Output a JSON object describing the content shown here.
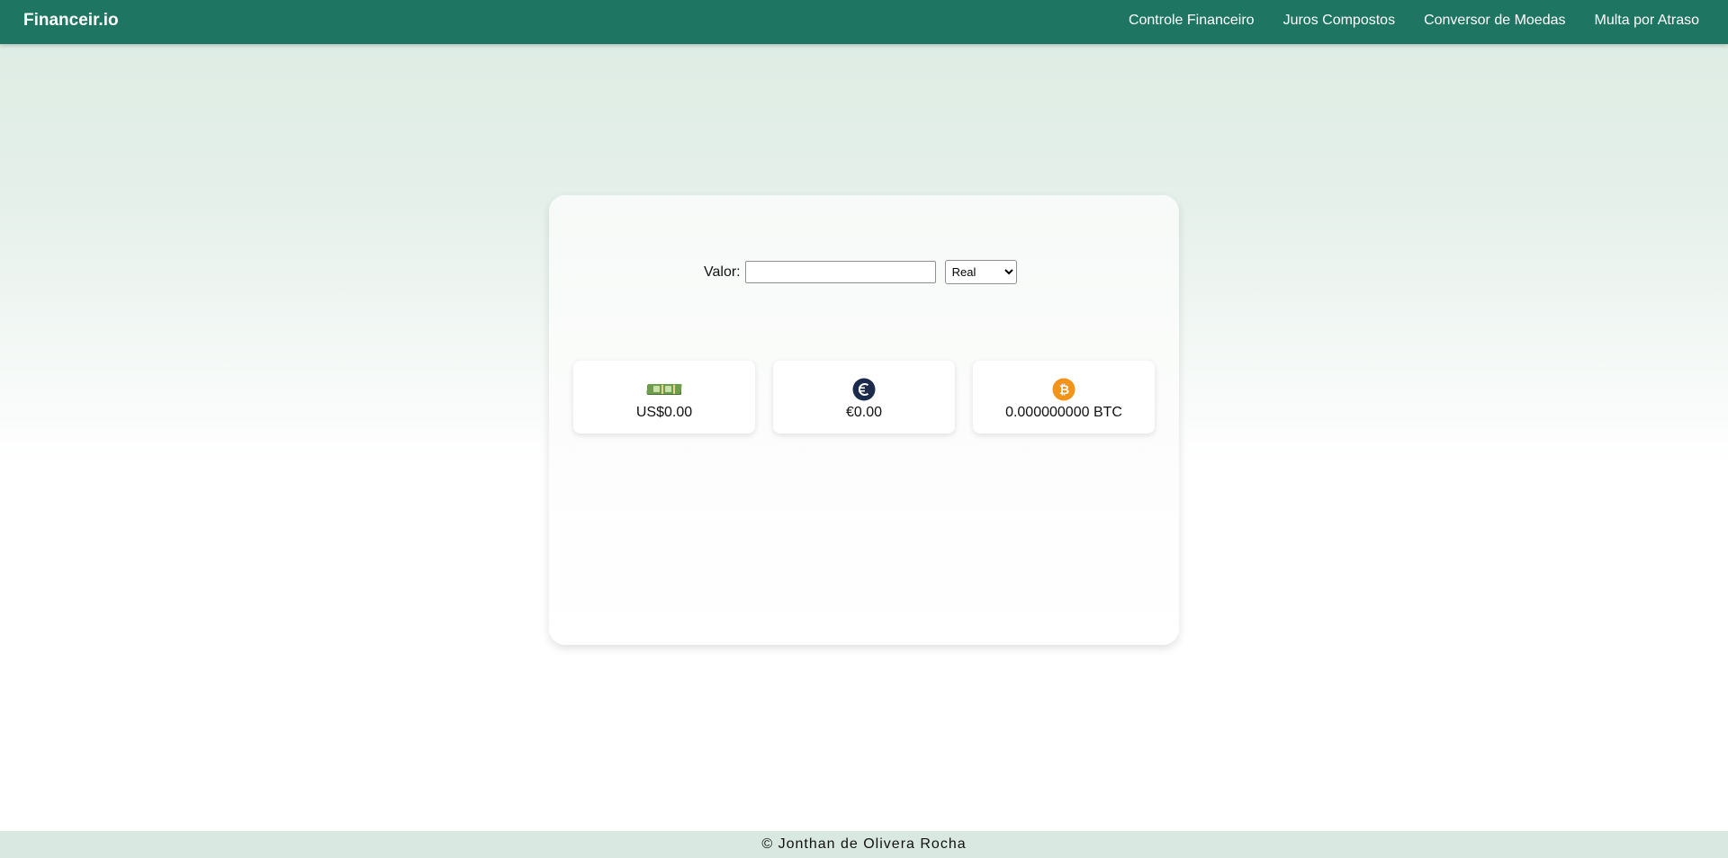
{
  "navbar": {
    "brand": "Financeir.io",
    "links": [
      {
        "label": "Controle Financeiro"
      },
      {
        "label": "Juros Compostos"
      },
      {
        "label": "Conversor de Moedas"
      },
      {
        "label": "Multa por Atraso"
      }
    ],
    "background_color": "#1e7562"
  },
  "converter": {
    "valor_label": "Valor:",
    "valor_input_value": "",
    "currency_selected": "Real",
    "results": [
      {
        "icon": "money-bills-icon",
        "value": "US$0.00"
      },
      {
        "icon": "euro-coin-icon",
        "value": "€0.00"
      },
      {
        "icon": "bitcoin-icon",
        "value": "0.000000000 BTC"
      }
    ]
  },
  "footer": {
    "text": "© Jonthan de Olivera Rocha"
  },
  "colors": {
    "accent": "#1e7562",
    "euro_icon": "#1c2a4c",
    "bitcoin_icon": "#f2931a",
    "money_icon": "#5b8f3e"
  }
}
